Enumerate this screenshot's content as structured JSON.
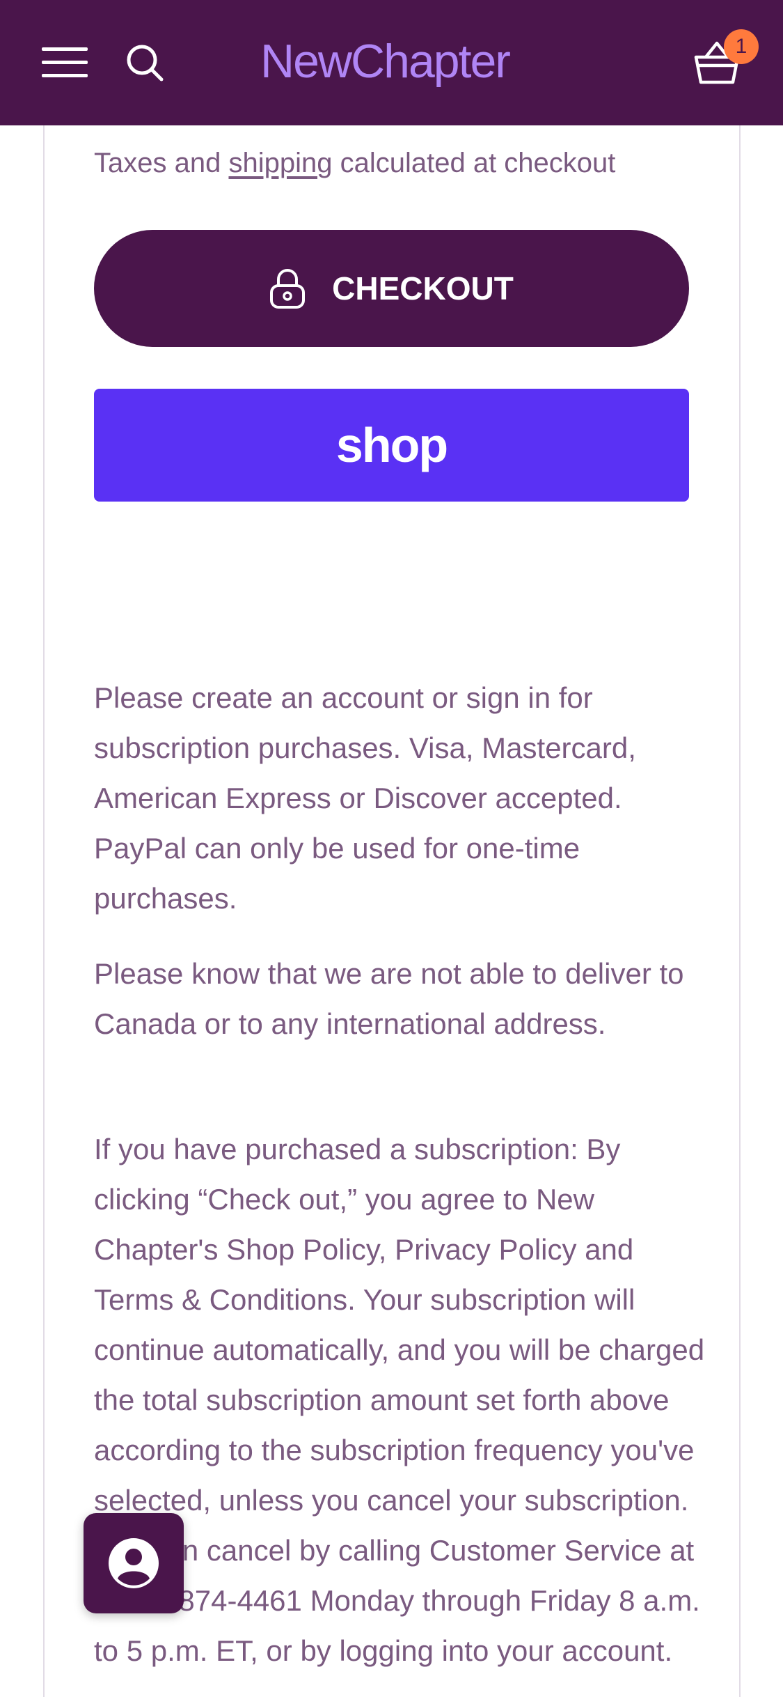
{
  "header": {
    "logo_text": "NewChapter",
    "cart_count": "1",
    "background": "#4a154b",
    "logo_color": "#b085f5",
    "badge_color": "#ff7a3d",
    "icons": [
      "menu-icon",
      "search-icon",
      "cart-icon"
    ]
  },
  "cart_summary": {
    "tax_note_prefix": "Taxes and ",
    "tax_note_link": "shipping",
    "tax_note_suffix": " calculated at checkout",
    "checkout_label": "CHECKOUT",
    "checkout_icon": "lock-icon",
    "shop_pay_label": "shop",
    "shop_pay_color": "#5a31f4"
  },
  "info": {
    "paragraph_1": "Please create an account or sign in for subscription purchases. Visa, Mastercard, American Express or Discover accepted. PayPal can only be used for one-time purchases.",
    "paragraph_2": "Please know that we are not able to deliver to Canada or to any international address.",
    "paragraph_3": "If you have purchased a subscription: By clicking “Check out,” you agree to New Chapter's Shop Policy, Privacy Policy and Terms & Conditions. Your subscription will continue automatically, and you will be charged the total subscription amount set forth above according to the subscription frequency you've selected, unless you cancel your subscription. You can cancel by calling Customer Service at 1-888-874-4461 Monday through Friday 8 a.m. to 5 p.m. ET, or by logging into your account."
  },
  "chat": {
    "icon": "person-icon"
  }
}
